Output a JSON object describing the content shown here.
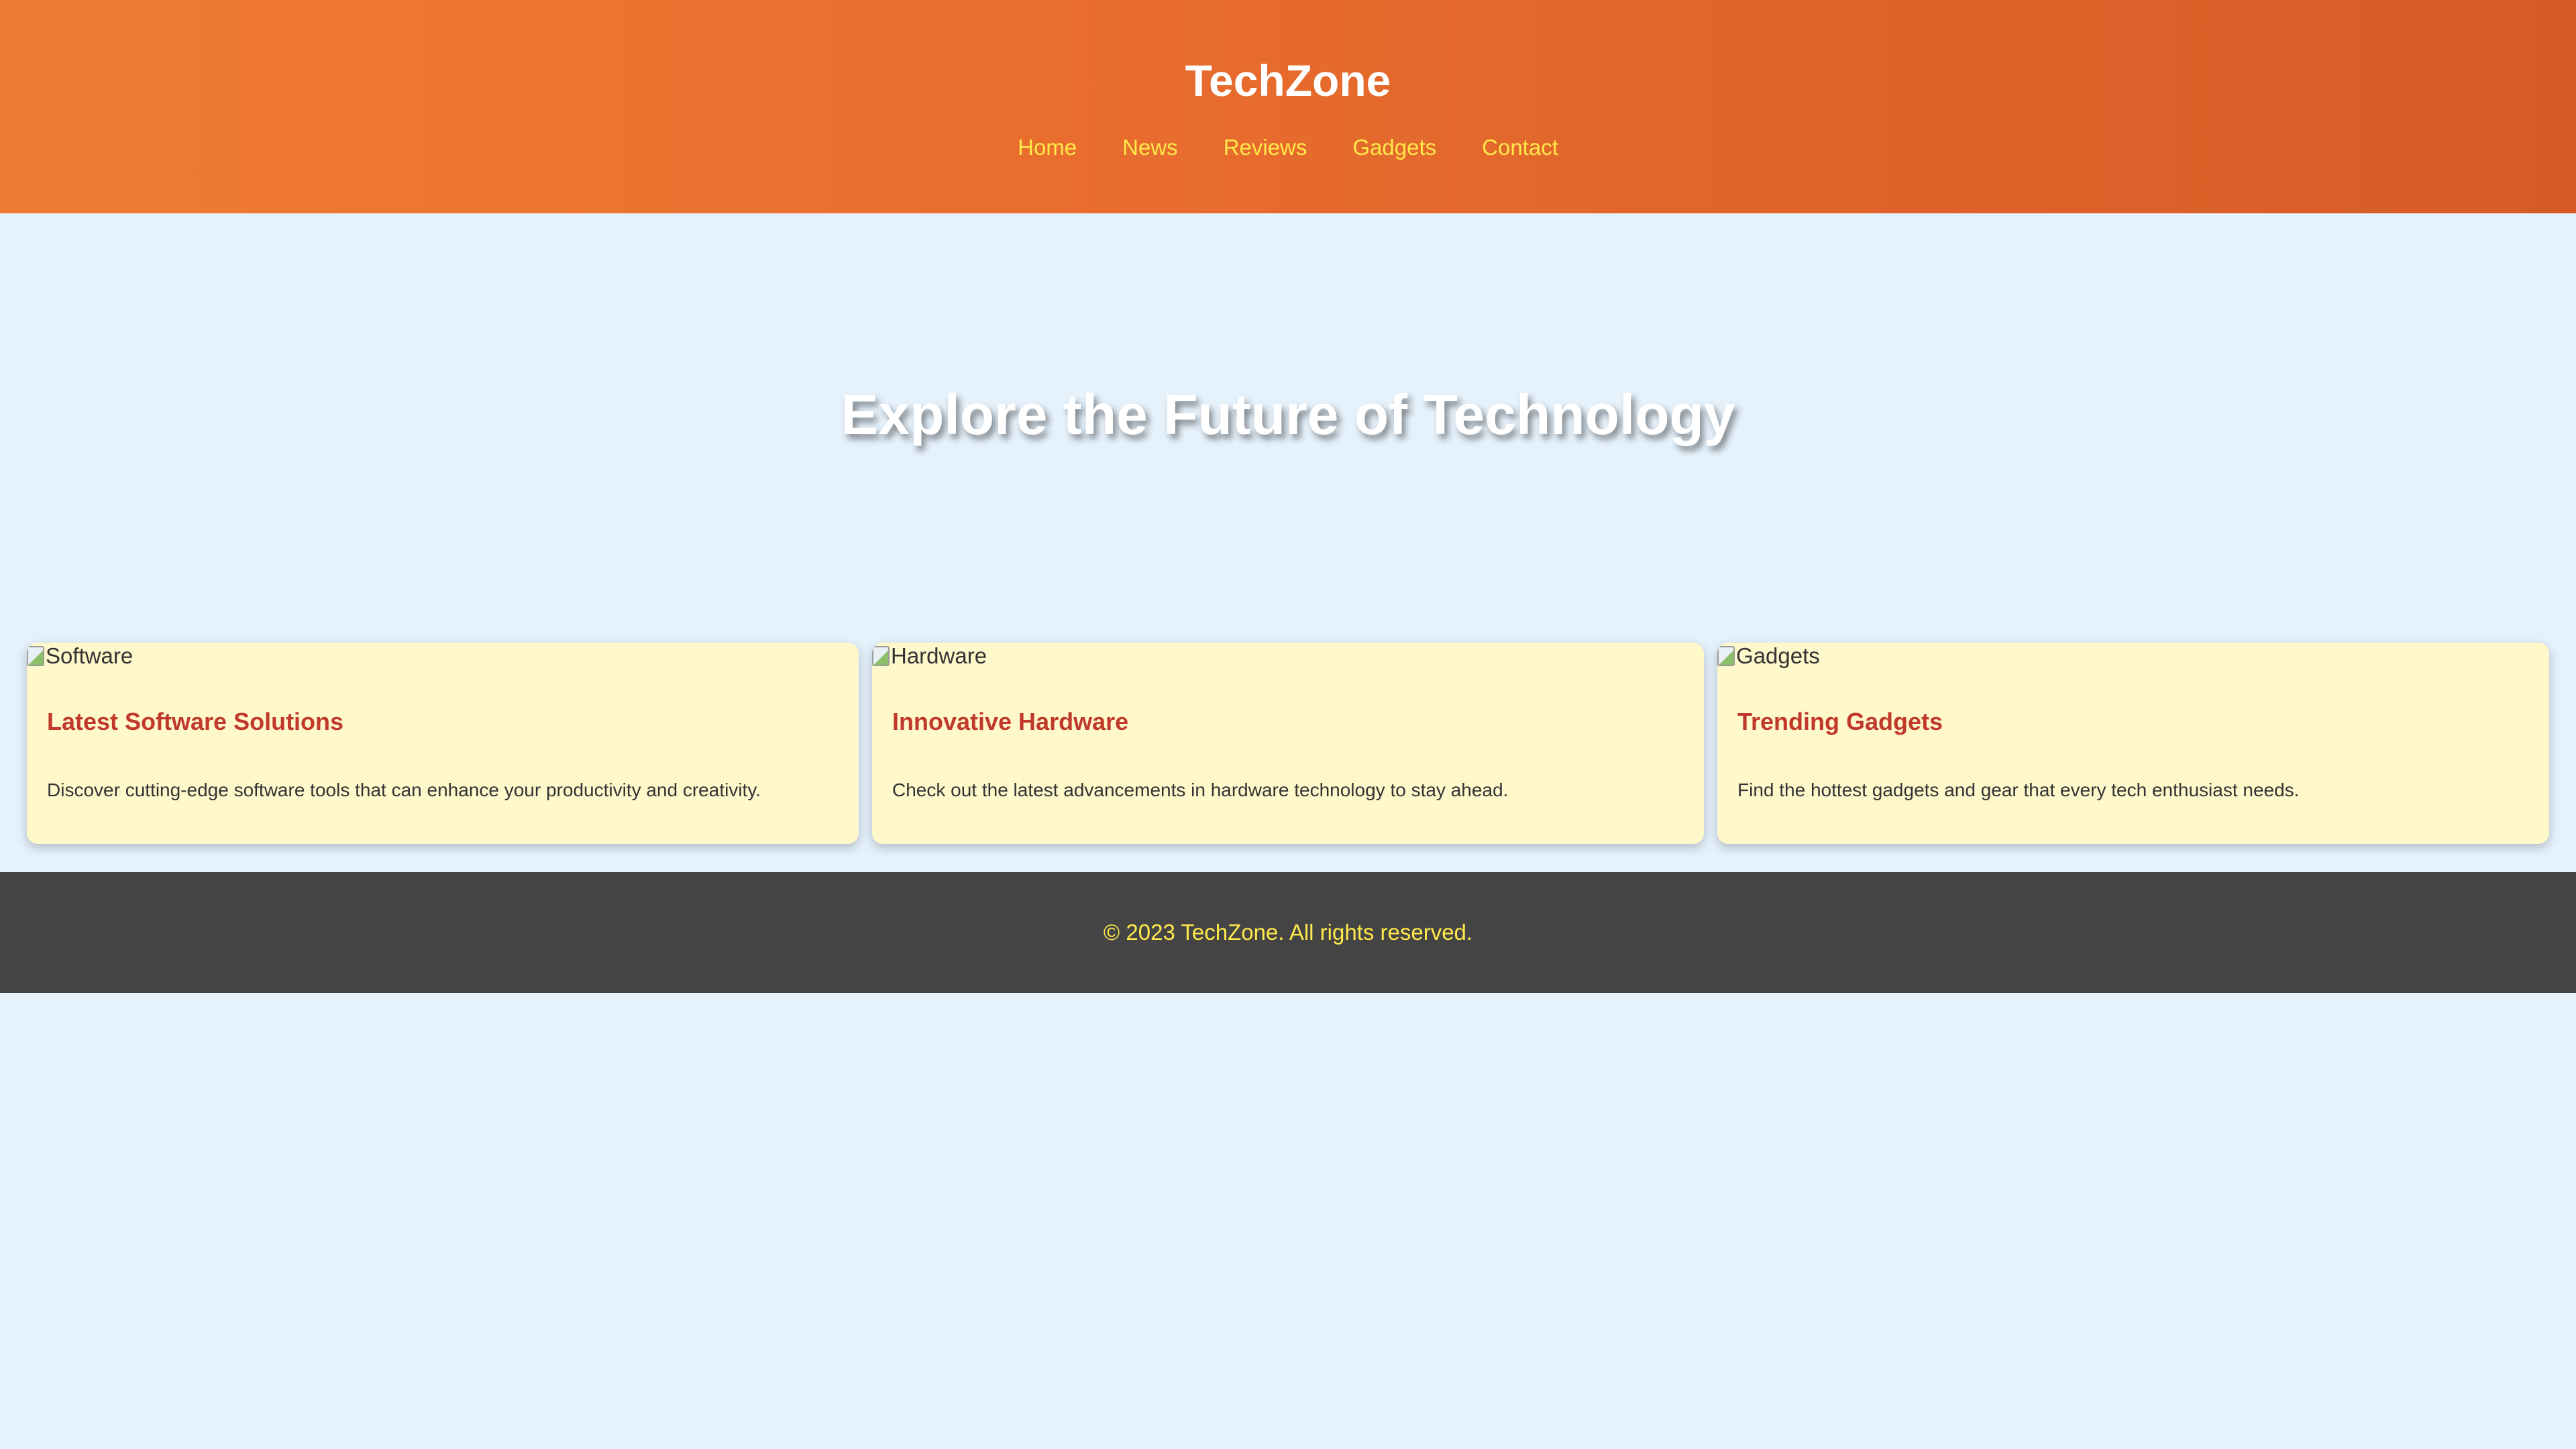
{
  "header": {
    "brand": "TechZone",
    "nav": [
      {
        "label": "Home"
      },
      {
        "label": "News"
      },
      {
        "label": "Reviews"
      },
      {
        "label": "Gadgets"
      },
      {
        "label": "Contact"
      }
    ]
  },
  "hero": {
    "title": "Explore the Future of Technology"
  },
  "cards": [
    {
      "image_alt": "Software",
      "title": "Latest Software Solutions",
      "text": "Discover cutting-edge software tools that can enhance your productivity and creativity."
    },
    {
      "image_alt": "Hardware",
      "title": "Innovative Hardware",
      "text": "Check out the latest advancements in hardware technology to stay ahead."
    },
    {
      "image_alt": "Gadgets",
      "title": "Trending Gadgets",
      "text": "Find the hottest gadgets and gear that every tech enthusiast needs."
    }
  ],
  "footer": {
    "text": "© 2023 TechZone. All rights reserved."
  },
  "colors": {
    "header_gradient_start": "#f07c34",
    "header_gradient_end": "#d65b27",
    "nav_link": "#ffe94a",
    "page_background": "#e5f1fb",
    "card_background": "#fef8cb",
    "card_title": "#c0392b",
    "footer_background": "#444444",
    "footer_text": "#ffe94a"
  },
  "icons": {
    "card_image": "broken-image-icon"
  }
}
